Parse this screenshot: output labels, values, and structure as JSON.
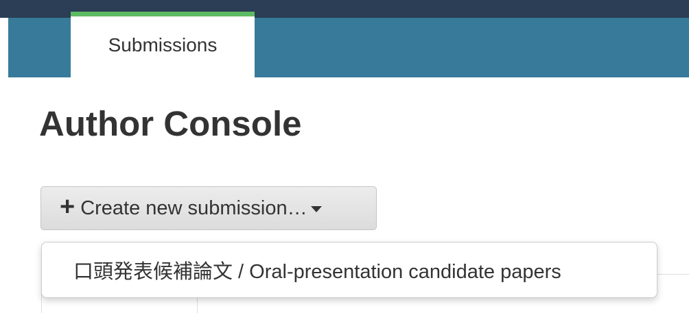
{
  "nav": {
    "tabs": [
      {
        "label": "Submissions",
        "active": true
      }
    ],
    "colors": {
      "topbar": "#2b3e55",
      "navbar": "#387a9a",
      "active_tab_accent": "#5dbb63"
    }
  },
  "page": {
    "title": "Author Console"
  },
  "create_button": {
    "icon": "plus-icon",
    "label": "Create new submission…",
    "dropdown_icon": "caret-down-icon"
  },
  "dropdown": {
    "items": [
      {
        "label": "口頭発表候補論文 / Oral-presentation candidate papers"
      }
    ]
  }
}
